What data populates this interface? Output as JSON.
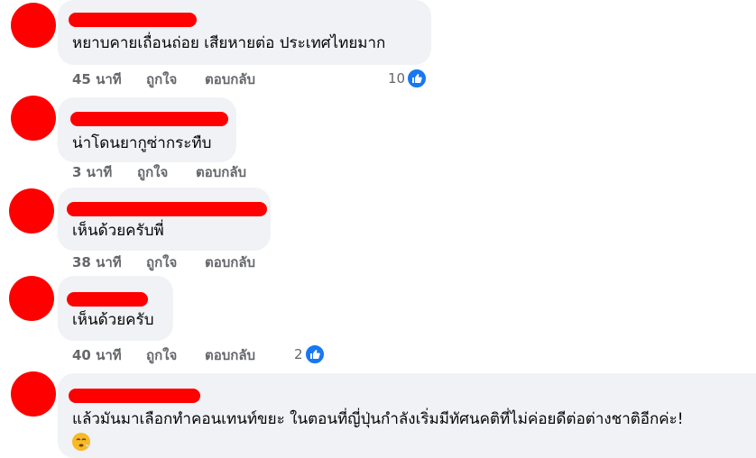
{
  "comments": [
    {
      "text": "หยาบคายเถื่อนถ่อย เสียหายต่อ ประเทศไทยมาก",
      "time": "45 นาที",
      "like": "ถูกใจ",
      "reply": "ตอบกลับ",
      "likes": "10"
    },
    {
      "text": "น่าโดนยากูซ่ากระทืบ",
      "time": "3 นาที",
      "like": "ถูกใจ",
      "reply": "ตอบกลับ"
    },
    {
      "text": "เห็นด้วยครับพี่",
      "time": "38 นาที",
      "like": "ถูกใจ",
      "reply": "ตอบกลับ"
    },
    {
      "text": "เห็นด้วยครับ",
      "time": "40 นาที",
      "like": "ถูกใจ",
      "reply": "ตอบกลับ",
      "likes": "2"
    },
    {
      "text": "แล้วมันมาเลือกทำคอนเทนท์ขยะ ในตอนที่ญี่ปุ่นกำลังเริ่มมีทัศนคติที่ไม่ค่อยดีต่อต่างชาติอีกค่ะ!",
      "emoji": "huffing-face-emoji"
    }
  ],
  "colors": {
    "redaction": "#ff0000",
    "bubble": "#f0f2f5",
    "meta": "#65676b",
    "like_blue": "#1877f2"
  },
  "icons": {
    "like": "thumbs-up-icon"
  }
}
